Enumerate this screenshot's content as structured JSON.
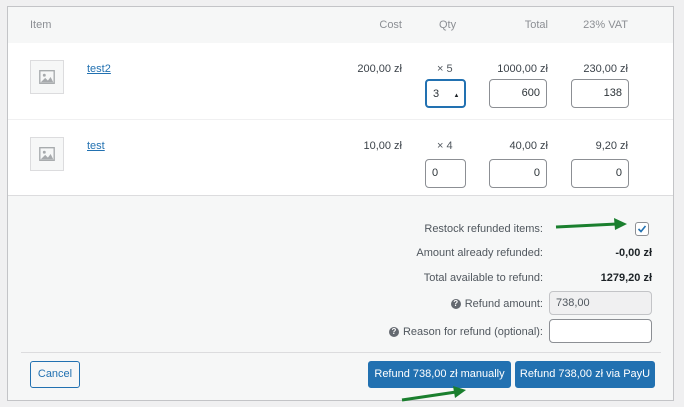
{
  "table_header": {
    "item": "Item",
    "cost": "Cost",
    "qty": "Qty",
    "total": "Total",
    "vat": "23% VAT"
  },
  "items": [
    {
      "name": "test2",
      "cost": "200,00 zł",
      "qty": "× 5",
      "total": "1000,00 zł",
      "vat": "230,00 zł",
      "refund_qty": "3",
      "refund_total": "600",
      "refund_vat": "138"
    },
    {
      "name": "test",
      "cost": "10,00 zł",
      "qty": "× 4",
      "total": "40,00 zł",
      "vat": "9,20 zł",
      "refund_qty": "0",
      "refund_total": "0",
      "refund_vat": "0"
    }
  ],
  "refund": {
    "restock_label": "Restock refunded items:",
    "restock_checked": true,
    "already_refunded_label": "Amount already refunded:",
    "already_refunded_value": "-0,00 zł",
    "available_label": "Total available to refund:",
    "available_value": "1279,20 zł",
    "amount_label": "Refund amount:",
    "amount_value": "738,00",
    "reason_label": "Reason for refund (optional):",
    "reason_value": ""
  },
  "buttons": {
    "cancel": "Cancel",
    "refund_manual": "Refund 738,00 zł manually",
    "refund_payu": "Refund 738,00 zł via PayU"
  },
  "colors": {
    "accent": "#2271b1",
    "annotation_arrow": "#1a7f2e"
  },
  "icons": {
    "thumbnail": "image-placeholder-icon",
    "help": "help-icon",
    "check": "checkmark-icon",
    "spinner": "number-spinner-icon"
  }
}
